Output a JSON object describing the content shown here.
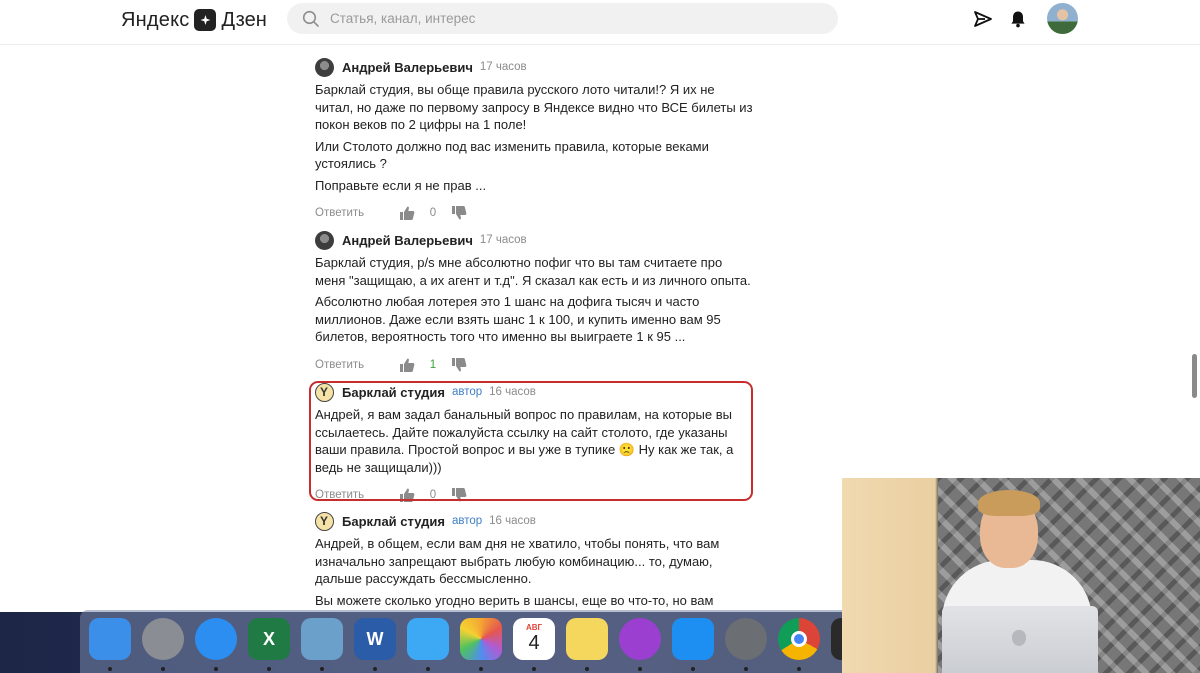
{
  "header": {
    "logo_word1": "Яндекс",
    "logo_word2": "Дзен",
    "search_placeholder": "Статья, канал, интерес"
  },
  "comments": [
    {
      "author": "Андрей Валерьевич",
      "badge": "",
      "time": "17 часов",
      "paragraphs": [
        "Барклай студия, вы обще правила русского лото читали!? Я их не читал, но даже по первому запросу в Яндексе видно что ВСЕ билеты из покон веков по 2 цифры на 1 поле!",
        "Или Столото должно под вас изменить правила, которые веками устоялись ?",
        "Поправьте если я не прав ..."
      ],
      "reply": "Ответить",
      "likes": "0"
    },
    {
      "author": "Андрей Валерьевич",
      "badge": "",
      "time": "17 часов",
      "paragraphs": [
        "Барклай студия, p/s мне абсолютно пофиг что вы там считаете про меня \"защищаю, а их агент и т.д\". Я сказал как есть и из личного опыта.",
        "Абсолютно любая лотерея это 1 шанс на дофига тысяч и часто миллионов. Даже если взять шанс 1 к 100, и купить именно вам 95 билетов, вероятность того что именно вы выиграете 1 к 95 ..."
      ],
      "reply": "Ответить",
      "likes": "1"
    },
    {
      "author": "Барклай студия",
      "badge": "автор",
      "time": "16 часов",
      "paragraphs": [
        "Андрей, я вам задал банальный вопрос по правилам, на которые вы ссылаетесь. Дайте пожалуйста ссылку на сайт столото, где указаны ваши правила. Простой вопрос и вы уже в тупике 🙁 Ну как же так, а ведь не защищали)))"
      ],
      "reply": "Ответить",
      "likes": "0"
    },
    {
      "author": "Барклай студия",
      "badge": "автор",
      "time": "16 часов",
      "paragraphs": [
        "Андрей, в общем, если вам дня не хватило, чтобы понять, что вам изначально запрещают выбрать любую комбинацию... то, думаю, дальше рассуждать бессмысленно.",
        "Вы можете сколько угодно верить в шансы, еще во что-то, но вам продают"
      ],
      "reply": "",
      "likes": ""
    }
  ],
  "dock": {
    "items": [
      {
        "name": "finder",
        "label": "",
        "color": "#3b8fe8"
      },
      {
        "name": "launchpad",
        "label": "",
        "color": "#8a8d94"
      },
      {
        "name": "safari",
        "label": "",
        "color": "#2c8ef0"
      },
      {
        "name": "excel",
        "label": "X",
        "color": "#1f7a43"
      },
      {
        "name": "preview",
        "label": "",
        "color": "#6aa0c9"
      },
      {
        "name": "word",
        "label": "W",
        "color": "#2b5ca8"
      },
      {
        "name": "messages",
        "label": "",
        "color": "#3da9f4"
      },
      {
        "name": "photos",
        "label": "",
        "color": "#f2f2f2"
      },
      {
        "name": "calendar",
        "label": "4",
        "color": "#ffffff",
        "month": "АВГ"
      },
      {
        "name": "notes",
        "label": "",
        "color": "#f6d75e"
      },
      {
        "name": "podcasts",
        "label": "",
        "color": "#9b3fd1"
      },
      {
        "name": "app-store",
        "label": "",
        "color": "#1d8ff2"
      },
      {
        "name": "system-preferences",
        "label": "",
        "color": "#6b6e73"
      },
      {
        "name": "chrome",
        "label": "",
        "color": "#ffffff"
      },
      {
        "name": "final-cut-pro",
        "label": "",
        "color": "#2a2a2a"
      }
    ]
  }
}
